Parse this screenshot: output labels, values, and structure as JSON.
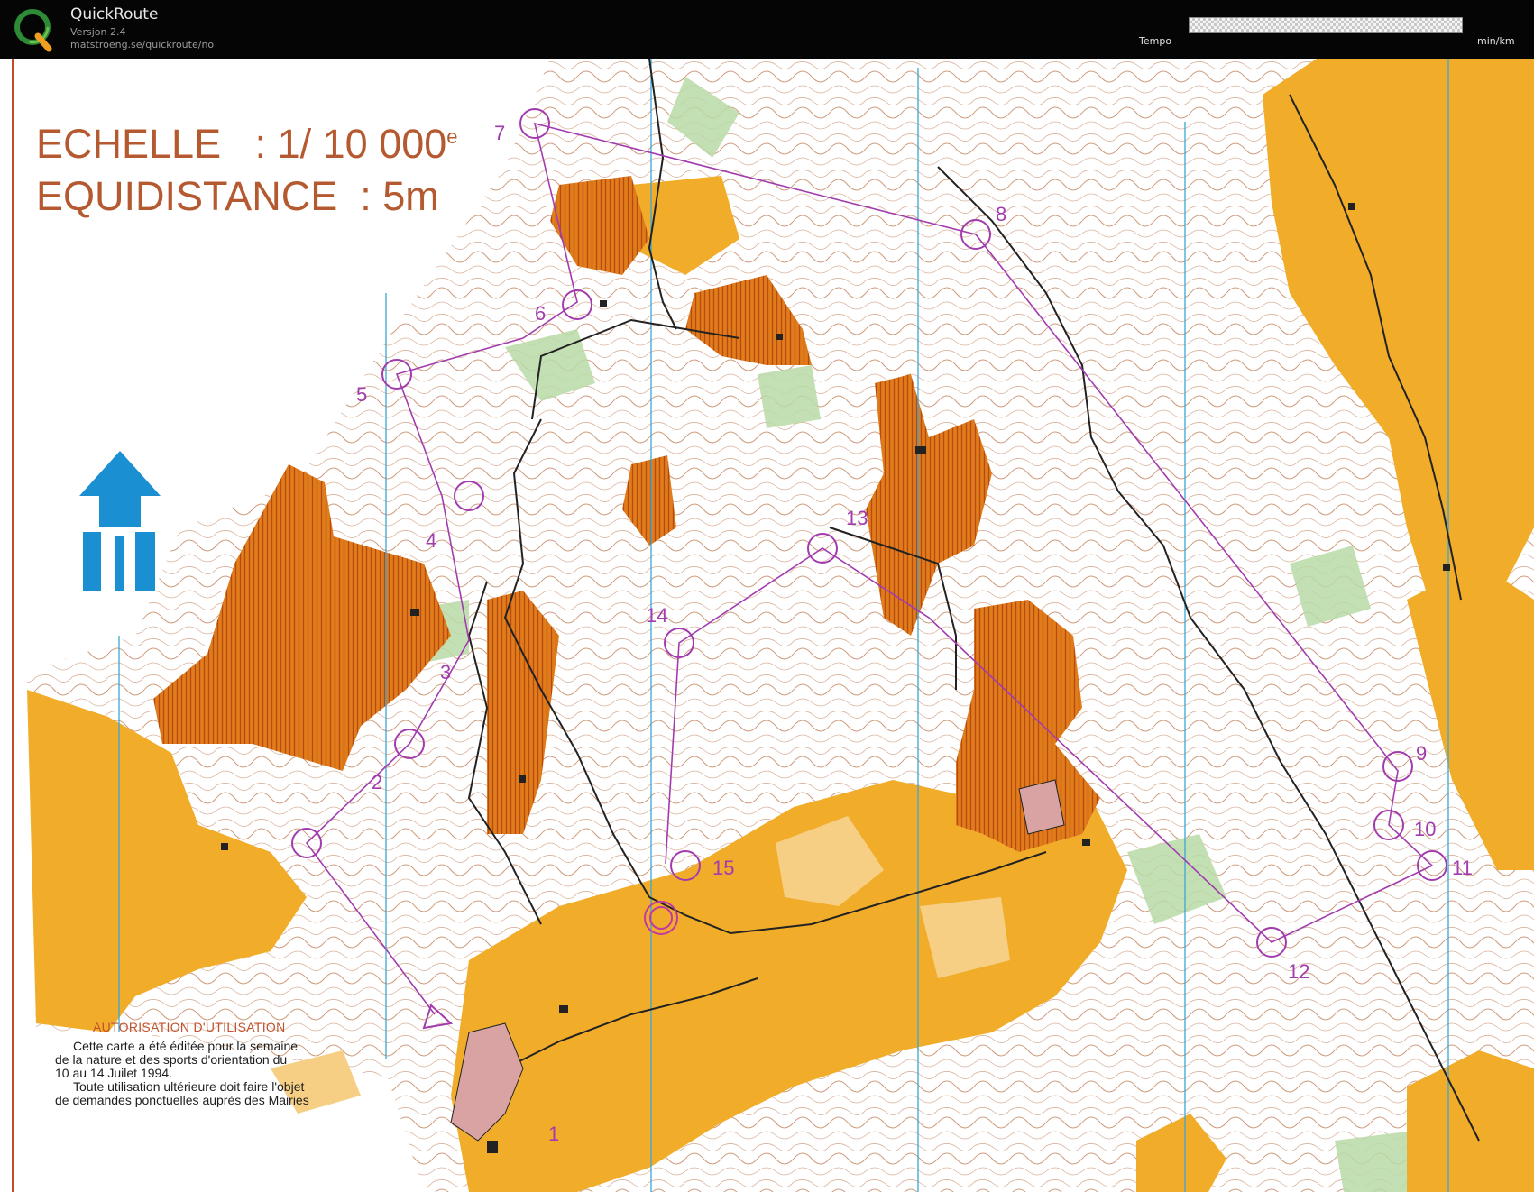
{
  "app": {
    "name": "QuickRoute",
    "version": "Versjon 2.4",
    "url": "matstroeng.se/quickroute/no",
    "tempo_label": "Tempo",
    "tempo_unit": "min/km",
    "logo_icon": "quickroute-q-logo-icon"
  },
  "map": {
    "scale_line": "ECHELLE   : 1/ 10 000",
    "scale_sup": "e",
    "equidistance_line": "EQUIDISTANCE  : 5m",
    "north_arrow_icon": "north-arrow-icon",
    "controls": [
      "1",
      "2",
      "3",
      "4",
      "5",
      "6",
      "7",
      "8",
      "9",
      "10",
      "11",
      "12",
      "13",
      "14",
      "15"
    ],
    "authorisation": {
      "title": "AUTORISATION  D'UTILISATION",
      "lines": [
        "Cette carte a été éditée pour la semaine",
        "de la nature et des sports d'orientation du",
        "10 au 14 Juilet 1994.",
        "Toute utilisation ultérieure doit faire l'objet",
        "de demandes ponctuelles auprès des Mairies"
      ]
    },
    "colors": {
      "course": "#a23cae",
      "open_land": "#f1ad2a",
      "rough_open": "#d96f16",
      "vegetation": "#a6cf96",
      "contour": "#b5652f",
      "magnetic_north": "#3aa6d6"
    }
  }
}
